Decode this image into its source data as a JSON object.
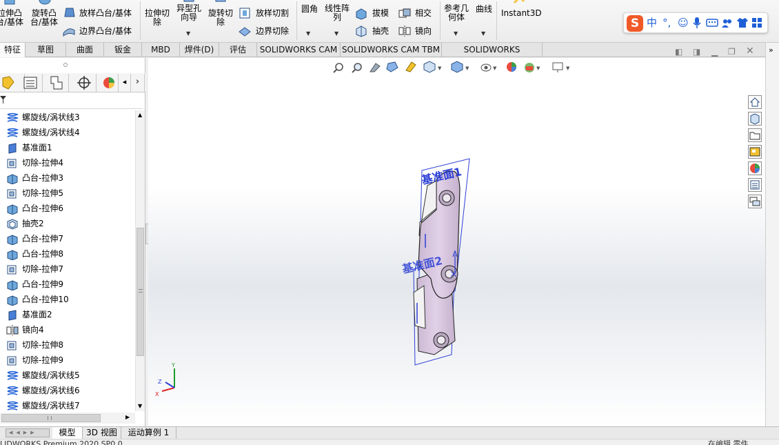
{
  "ribbon": {
    "extrude_boss": "拉伸凸\n台/基体",
    "revolve_boss": "旋转凸\n台/基体",
    "loft_boss": "放样凸台/基体",
    "boundary_boss": "边界凸台/基体",
    "extrude_cut": "拉伸切\n除",
    "hole_wizard": "异型孔\n向导",
    "revolve_cut": "旋转切\n除",
    "loft_cut": "放样切割",
    "boundary_cut": "边界切除",
    "fillet": "圆角",
    "linear_pattern": "线性阵\n列",
    "draft": "拔模",
    "shell": "抽壳",
    "intersect": "相交",
    "mirror": "镜向",
    "ref_geometry": "参考几\n何体",
    "curves": "曲线",
    "instant3d": "Instant3D"
  },
  "ime": {
    "mode": "中",
    "punct": "°,"
  },
  "tabs": [
    {
      "label": "特征"
    },
    {
      "label": "草图"
    },
    {
      "label": "曲面"
    },
    {
      "label": "钣金"
    },
    {
      "label": "MBD"
    },
    {
      "label": "焊件(D)"
    },
    {
      "label": "评估"
    },
    {
      "label": "SOLIDWORKS CAM"
    },
    {
      "label": "SOLIDWORKS CAM TBM"
    },
    {
      "label": "SOLIDWORKS Inspection"
    }
  ],
  "tree": [
    {
      "label": "螺旋线/涡状线3",
      "icon": "helix-icon"
    },
    {
      "label": "螺旋线/涡状线4",
      "icon": "helix-icon"
    },
    {
      "label": "基准面1",
      "icon": "plane-icon"
    },
    {
      "label": "切除-拉伸4",
      "icon": "cut-extrude-icon"
    },
    {
      "label": "凸台-拉伸3",
      "icon": "boss-extrude-icon"
    },
    {
      "label": "切除-拉伸5",
      "icon": "cut-extrude-icon"
    },
    {
      "label": "凸台-拉伸6",
      "icon": "boss-extrude-icon"
    },
    {
      "label": "抽壳2",
      "icon": "shell-icon"
    },
    {
      "label": "凸台-拉伸7",
      "icon": "boss-extrude-icon"
    },
    {
      "label": "凸台-拉伸8",
      "icon": "boss-extrude-icon"
    },
    {
      "label": "切除-拉伸7",
      "icon": "cut-extrude-icon"
    },
    {
      "label": "凸台-拉伸9",
      "icon": "boss-extrude-icon"
    },
    {
      "label": "凸台-拉伸10",
      "icon": "boss-extrude-icon"
    },
    {
      "label": "基准面2",
      "icon": "plane-icon"
    },
    {
      "label": "镜向4",
      "icon": "mirror-icon"
    },
    {
      "label": "切除-拉伸8",
      "icon": "cut-extrude-icon"
    },
    {
      "label": "切除-拉伸9",
      "icon": "cut-extrude-icon"
    },
    {
      "label": "螺旋线/涡状线5",
      "icon": "helix-icon"
    },
    {
      "label": "螺旋线/涡状线6",
      "icon": "helix-icon"
    },
    {
      "label": "螺旋线/涡状线7",
      "icon": "helix-icon"
    }
  ],
  "viewport": {
    "plane1_label": "基准面1",
    "plane2_label": "基准面2",
    "triad": {
      "x": "X",
      "y": "Y",
      "z": "Z"
    }
  },
  "bottom_tabs": [
    {
      "label": "模型"
    },
    {
      "label": "3D 视图"
    },
    {
      "label": "运动算例 1"
    }
  ],
  "status": {
    "left": "LIDWORKS Premium 2020 SP0.0",
    "right": "在编辑 零件"
  },
  "colors": {
    "part_face": "#d9c7e0",
    "plane_blue": "#2b3fd6",
    "accent_orange": "#f05a28"
  }
}
